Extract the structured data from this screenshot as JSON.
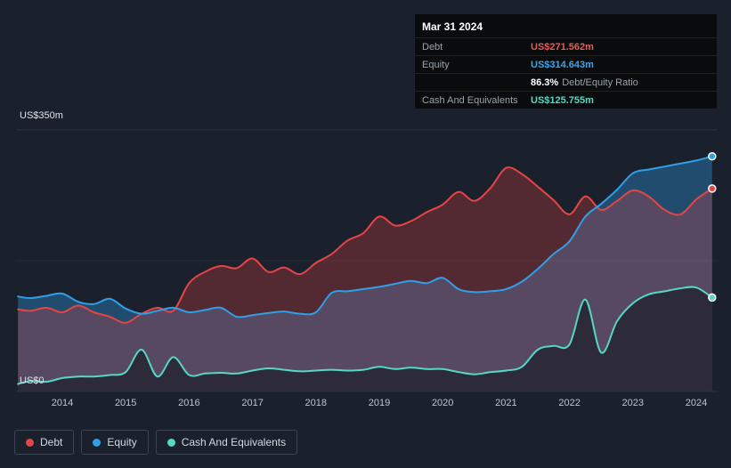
{
  "panel": {
    "background": "#1b212c"
  },
  "tooltip": {
    "date": "Mar 31 2024",
    "rows": [
      {
        "label": "Debt",
        "value": "US$271.562m",
        "color": "#e35c5c"
      },
      {
        "label": "Equity",
        "value": "US$314.643m",
        "color": "#39a5ec"
      },
      {
        "label": "",
        "value_bold": "86.3%",
        "value_rest": "Debt/Equity Ratio"
      },
      {
        "label": "Cash And Equivalents",
        "value": "US$125.755m",
        "color": "#55d8c4"
      }
    ]
  },
  "axis": {
    "y_top_label": "US$350m",
    "y_bottom_label": "US$0"
  },
  "legend": {
    "items": [
      {
        "label": "Debt",
        "color": "#e64545"
      },
      {
        "label": "Equity",
        "color": "#2f9fe8"
      },
      {
        "label": "Cash And Equivalents",
        "color": "#55d8c4"
      }
    ]
  },
  "chart_data": {
    "type": "area",
    "y_unit": "US$m",
    "ylim": [
      0,
      350
    ],
    "x_ticks": [
      2014,
      2015,
      2016,
      2017,
      2018,
      2019,
      2020,
      2021,
      2022,
      2023,
      2024
    ],
    "y_gridlines": [
      {
        "value": 350,
        "strong": true
      },
      {
        "value": 175,
        "strong": false
      },
      {
        "value": 0,
        "strong": true
      }
    ],
    "x": [
      2013.3,
      2013.5,
      2013.75,
      2014,
      2014.25,
      2014.5,
      2014.75,
      2015,
      2015.25,
      2015.5,
      2015.75,
      2016,
      2016.25,
      2016.5,
      2016.75,
      2017,
      2017.25,
      2017.5,
      2017.75,
      2018,
      2018.25,
      2018.5,
      2018.75,
      2019,
      2019.25,
      2019.5,
      2019.75,
      2020,
      2020.25,
      2020.5,
      2020.75,
      2021,
      2021.25,
      2021.5,
      2021.75,
      2022,
      2022.25,
      2022.5,
      2022.75,
      2023,
      2023.25,
      2023.5,
      2023.75,
      2024,
      2024.25
    ],
    "series": [
      {
        "name": "Debt",
        "color": "#e64545",
        "fill": "rgba(230,69,69,0.28)",
        "values": [
          110,
          108,
          112,
          106,
          115,
          106,
          100,
          92,
          104,
          112,
          108,
          145,
          160,
          168,
          165,
          178,
          160,
          166,
          157,
          172,
          184,
          202,
          212,
          234,
          222,
          228,
          240,
          250,
          267,
          255,
          272,
          299,
          291,
          274,
          256,
          237,
          261,
          243,
          255,
          269,
          261,
          243,
          237,
          257,
          271.562
        ]
      },
      {
        "name": "Equity",
        "color": "#2f9fe8",
        "fill": "rgba(47,159,232,0.35)",
        "values": [
          127,
          125,
          128,
          131,
          120,
          117,
          124,
          111,
          104,
          108,
          112,
          106,
          109,
          112,
          100,
          102,
          105,
          107,
          104,
          106,
          132,
          134,
          137,
          140,
          144,
          148,
          145,
          152,
          137,
          133,
          134,
          137,
          147,
          164,
          184,
          201,
          234,
          251,
          270,
          292,
          297,
          301,
          305,
          309,
          314.643
        ]
      },
      {
        "name": "Cash And Equivalents",
        "color": "#55d8c4",
        "fill": "rgba(19,26,34,0.62)",
        "values": [
          10,
          14,
          13,
          18,
          20,
          20,
          22,
          26,
          56,
          20,
          46,
          22,
          24,
          25,
          24,
          28,
          31,
          29,
          27,
          28,
          29,
          28,
          29,
          33,
          30,
          32,
          30,
          30,
          26,
          23,
          26,
          28,
          33,
          56,
          61,
          63,
          123,
          52,
          94,
          118,
          130,
          134,
          138,
          139,
          125.755
        ]
      }
    ],
    "fill_order": [
      "Equity",
      "Debt",
      "Cash And Equivalents"
    ],
    "stroke_order": [
      "Debt",
      "Equity",
      "Cash And Equivalents"
    ],
    "end_values": {
      "Debt": 271.562,
      "Equity": 314.643,
      "Cash And Equivalents": 125.755
    }
  }
}
